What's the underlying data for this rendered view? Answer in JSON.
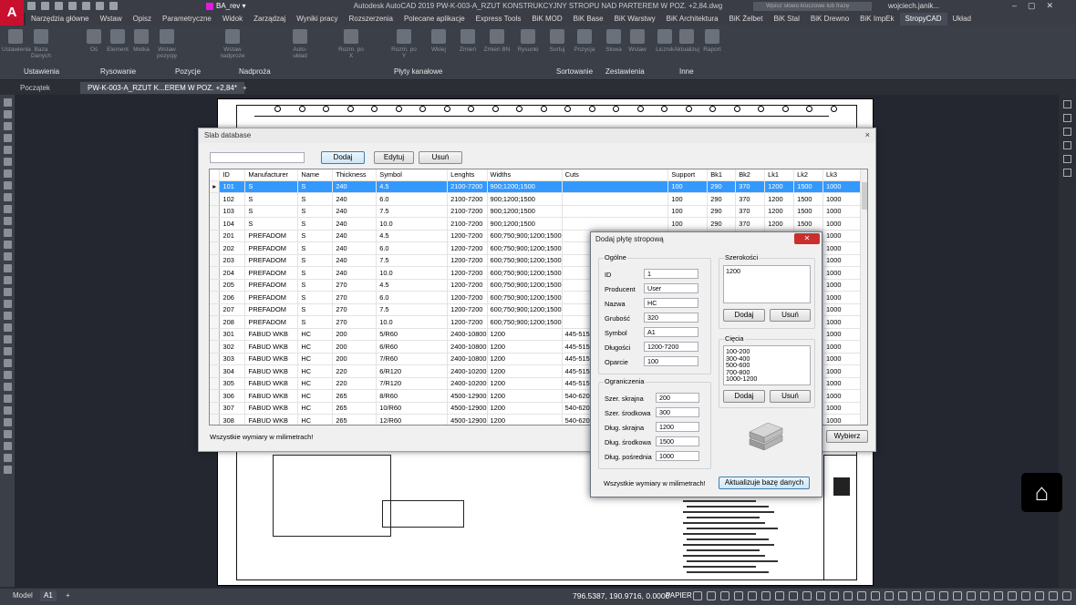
{
  "app": {
    "logo": "A",
    "title": "Autodesk AutoCAD 2019   PW-K-003-A_RZUT KONSTRUKCYJNY STROPU NAD PARTEREM W POZ. +2,84.dwg",
    "workspace": "BA_rev",
    "search_placeholder": "Wpisz słowo kluczowe lub frazę",
    "user": "wojciech.janik..."
  },
  "menu": [
    "Narzędzia główne",
    "Wstaw",
    "Opisz",
    "Parametryczne",
    "Widok",
    "Zarządzaj",
    "Wyniki pracy",
    "Rozszerzenia",
    "Polecane aplikacje",
    "Express Tools",
    "BiK MOD",
    "BiK Base",
    "BiK Warstwy",
    "BiK Architektura",
    "BiK Żelbet",
    "BiK Stal",
    "BiK Drewno",
    "BiK ImpEk",
    "StropyCAD",
    "Układ"
  ],
  "menu_active": "StropyCAD",
  "ribbon": {
    "buttons": [
      {
        "label": "Ustawienia"
      },
      {
        "label": "Baza Danych"
      },
      {
        "label": "Oś"
      },
      {
        "label": "Element"
      },
      {
        "label": "Metka"
      },
      {
        "label": "Wstaw pozycję"
      },
      {
        "label": "Wstaw nadproże"
      },
      {
        "label": "Auto-układ"
      },
      {
        "label": "Rozm. po X"
      },
      {
        "label": "Rozm. po Y"
      },
      {
        "label": "Wklej"
      },
      {
        "label": "Zmień"
      },
      {
        "label": "Zmień BN"
      },
      {
        "label": "Rysunki"
      },
      {
        "label": "Sortuj"
      },
      {
        "label": "Pozycja"
      },
      {
        "label": "Słowa"
      },
      {
        "label": "Wstaw"
      },
      {
        "label": "Licznik"
      },
      {
        "label": "Aktualizuj"
      },
      {
        "label": "Raport"
      }
    ],
    "panels": [
      "Ustawienia",
      "Rysowanie",
      "Pozycje",
      "Nadproża",
      "Płyty kanałowe",
      "Sortowanie",
      "Zestawienia",
      "Inne"
    ]
  },
  "tabs": [
    "Początek",
    "PW-K-003-A_RZUT K...EREM W POZ. +2,84*",
    "+"
  ],
  "status": {
    "model": "Model",
    "layout": "A1",
    "coords": "796.5387, 190.9716, 0.0000",
    "space": "PAPIER"
  },
  "slab_db": {
    "title": "Slab database",
    "close": "×",
    "buttons": {
      "add": "Dodaj",
      "edit": "Edytuj",
      "delete": "Usuń",
      "choose": "Wybierz"
    },
    "footer": "Wszystkie wymiary w milimetrach!",
    "columns": [
      "ID",
      "Manufacturer",
      "Name",
      "Thickness",
      "Symbol",
      "Lenghts",
      "Widths",
      "Cuts",
      "Support",
      "Bk1",
      "Bk2",
      "Lk1",
      "Lk2",
      "Lk3"
    ],
    "rows": [
      [
        "101",
        "S",
        "S",
        "240",
        "4.5",
        "2100-7200",
        "900;1200;1500",
        "",
        "100",
        "290",
        "370",
        "1200",
        "1500",
        "1000"
      ],
      [
        "102",
        "S",
        "S",
        "240",
        "6.0",
        "2100-7200",
        "900;1200;1500",
        "",
        "100",
        "290",
        "370",
        "1200",
        "1500",
        "1000"
      ],
      [
        "103",
        "S",
        "S",
        "240",
        "7.5",
        "2100-7200",
        "900;1200;1500",
        "",
        "100",
        "290",
        "370",
        "1200",
        "1500",
        "1000"
      ],
      [
        "104",
        "S",
        "S",
        "240",
        "10.0",
        "2100-7200",
        "900;1200;1500",
        "",
        "100",
        "290",
        "370",
        "1200",
        "1500",
        "1000"
      ],
      [
        "201",
        "PREFADOM",
        "S",
        "240",
        "4.5",
        "1200-7200",
        "600;750;900;1200;1500",
        "",
        "",
        "",
        "",
        "",
        "",
        "1000"
      ],
      [
        "202",
        "PREFADOM",
        "S",
        "240",
        "6.0",
        "1200-7200",
        "600;750;900;1200;1500",
        "",
        "",
        "",
        "",
        "",
        "",
        "1000"
      ],
      [
        "203",
        "PREFADOM",
        "S",
        "240",
        "7.5",
        "1200-7200",
        "600;750;900;1200;1500",
        "",
        "",
        "",
        "",
        "",
        "",
        "1000"
      ],
      [
        "204",
        "PREFADOM",
        "S",
        "240",
        "10.0",
        "1200-7200",
        "600;750;900;1200;1500",
        "",
        "",
        "",
        "",
        "",
        "",
        "1000"
      ],
      [
        "205",
        "PREFADOM",
        "S",
        "270",
        "4.5",
        "1200-7200",
        "600;750;900;1200;1500",
        "",
        "",
        "",
        "",
        "",
        "",
        "1000"
      ],
      [
        "206",
        "PREFADOM",
        "S",
        "270",
        "6.0",
        "1200-7200",
        "600;750;900;1200;1500",
        "",
        "",
        "",
        "",
        "",
        "",
        "1000"
      ],
      [
        "207",
        "PREFADOM",
        "S",
        "270",
        "7.5",
        "1200-7200",
        "600;750;900;1200;1500",
        "",
        "",
        "",
        "",
        "",
        "",
        "1000"
      ],
      [
        "208",
        "PREFADOM",
        "S",
        "270",
        "10.0",
        "1200-7200",
        "600;750;900;1200;1500",
        "",
        "",
        "",
        "",
        "",
        "",
        "1000"
      ],
      [
        "301",
        "FABUD WKB",
        "HC",
        "200",
        "5/R60",
        "2400-10800",
        "1200",
        "445-515",
        "",
        "",
        "",
        "",
        "",
        "1000"
      ],
      [
        "302",
        "FABUD WKB",
        "HC",
        "200",
        "6/R60",
        "2400-10800",
        "1200",
        "445-515",
        "",
        "",
        "",
        "",
        "",
        "1000"
      ],
      [
        "303",
        "FABUD WKB",
        "HC",
        "200",
        "7/R60",
        "2400-10800",
        "1200",
        "445-515",
        "",
        "",
        "",
        "",
        "",
        "1000"
      ],
      [
        "304",
        "FABUD WKB",
        "HC",
        "220",
        "6/R120",
        "2400-10200",
        "1200",
        "445-515",
        "",
        "",
        "",
        "",
        "",
        "1000"
      ],
      [
        "305",
        "FABUD WKB",
        "HC",
        "220",
        "7/R120",
        "2400-10200",
        "1200",
        "445-515",
        "",
        "",
        "",
        "",
        "",
        "1000"
      ],
      [
        "306",
        "FABUD WKB",
        "HC",
        "265",
        "8/R60",
        "4500-12900",
        "1200",
        "540-620",
        "",
        "",
        "",
        "",
        "",
        "1000"
      ],
      [
        "307",
        "FABUD WKB",
        "HC",
        "265",
        "10/R60",
        "4500-12900",
        "1200",
        "540-620",
        "",
        "",
        "",
        "",
        "",
        "1000"
      ],
      [
        "308",
        "FABUD WKB",
        "HC",
        "265",
        "12/R60",
        "4500-12900",
        "1200",
        "540-620",
        "",
        "",
        "",
        "",
        "",
        "1000"
      ]
    ]
  },
  "add_slab": {
    "title": "Dodaj płytę stropową",
    "close": "✕",
    "general_title": "Ogólne",
    "fields": [
      {
        "label": "ID",
        "value": "1"
      },
      {
        "label": "Producent",
        "value": "User"
      },
      {
        "label": "Nazwa",
        "value": "HC"
      },
      {
        "label": "Grubość",
        "value": "320"
      },
      {
        "label": "Symbol",
        "value": "A1"
      },
      {
        "label": "Długości",
        "value": "1200-7200"
      },
      {
        "label": "Oparcie",
        "value": "100"
      }
    ],
    "limits_title": "Ograniczenia",
    "limits": [
      {
        "label": "Szer. skrajna",
        "value": "200"
      },
      {
        "label": "Szer. środkowa",
        "value": "300"
      },
      {
        "label": "Dług. skrajna",
        "value": "1200"
      },
      {
        "label": "Dług. środkowa",
        "value": "1500"
      },
      {
        "label": "Dług. pośrednia",
        "value": "1000"
      }
    ],
    "widths_title": "Szerokości",
    "widths": [
      "1200"
    ],
    "cuts_title": "Cięcia",
    "cuts": [
      "100-200",
      "300-400",
      "500-600",
      "700-800",
      "1000-1200"
    ],
    "add": "Dodaj",
    "delete": "Usuń",
    "footer": "Wszystkie wymiary w milimetrach!",
    "update": "Aktualizuje bazę danych"
  }
}
